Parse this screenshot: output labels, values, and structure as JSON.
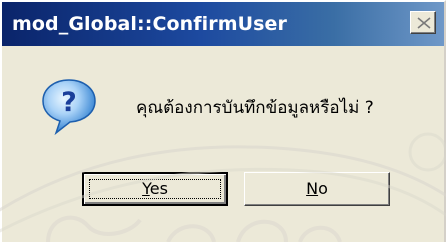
{
  "dialog": {
    "title": "mod_Global::ConfirmUser",
    "message": "คุณต้องการบันทึกข้อมูลหรือไม่ ?",
    "icon": "question-icon",
    "close_icon": "close-icon"
  },
  "buttons": {
    "yes": {
      "mnemonic": "Y",
      "rest": "es"
    },
    "no": {
      "mnemonic": "N",
      "rest": "o"
    }
  },
  "colors": {
    "titlebar_start": "#0a246a",
    "titlebar_end": "#6f98c8",
    "face": "#ece9d8",
    "icon_blue": "#1e6fd6"
  }
}
